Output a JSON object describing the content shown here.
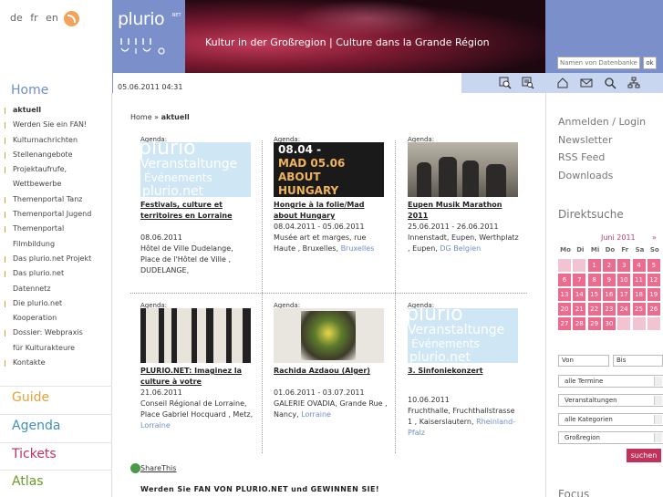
{
  "header": {
    "languages": [
      "de",
      "fr",
      "en"
    ],
    "logo_text": "plurio",
    "logo_net": ".NET",
    "tagline": "Kultur in der Großregion | Culture dans la Grande Région",
    "search_placeholder": "Namen von Datenbanken",
    "search_button": "ok"
  },
  "datetime": "05.06.2011 04:31",
  "left_nav": {
    "home": "Home",
    "items": [
      {
        "label": "aktuell",
        "active": true
      },
      {
        "label": "Werden Sie ein FAN!"
      },
      {
        "label": "Kulturnachrichten"
      },
      {
        "label": "Stellenangebote"
      },
      {
        "label": "Projektaufrufe,"
      },
      {
        "label": "Wettbewerbe",
        "plain": true
      },
      {
        "label": "Themenportal Tanz"
      },
      {
        "label": "Themenportal Jugend"
      },
      {
        "label": "Themenportal"
      },
      {
        "label": "Filmbildung",
        "plain": true
      },
      {
        "label": "Das plurio.net Projekt"
      },
      {
        "label": "Das plurio.net"
      },
      {
        "label": "Datennetz",
        "plain": true
      },
      {
        "label": "Die plurio.net"
      },
      {
        "label": "Kooperation",
        "plain": true
      },
      {
        "label": "Dossier: Webpraxis"
      },
      {
        "label": "für Kulturakteure",
        "plain": true
      },
      {
        "label": "Kontakte"
      }
    ],
    "sections": [
      {
        "label": "Guide",
        "color": "#e3a23a"
      },
      {
        "label": "Agenda",
        "color": "#3f8fb9"
      },
      {
        "label": "Tickets",
        "color": "#c2305c"
      },
      {
        "label": "Atlas",
        "color": "#6a9a2a"
      }
    ]
  },
  "breadcrumb": {
    "home": "Home",
    "sep": "»",
    "current": "aktuell"
  },
  "cards": [
    {
      "label": "Agenda:",
      "img": "ph",
      "title": "Festivals, culture et territoires en Lorraine",
      "dates": "08.06.2011",
      "place": "Hôtel de Ville Dudelange, Place de l'Hôtel de Ville , DUDELANGE,",
      "city": ""
    },
    {
      "label": "Agenda:",
      "img": "mad",
      "title": "Hongrie à la folie/Mad about Hungary",
      "dates": "08.04.2011 - 05.06.2011",
      "place": "Musée art et marges, rue Haute , Bruxelles,",
      "city": "Bruxelles"
    },
    {
      "label": "Agenda:",
      "img": "photo1",
      "title": "Eupen Musik Marathon 2011",
      "dates": "25.06.2011 - 26.06.2011",
      "place": "Innenstadt, Eupen, Werthplatz , Eupen,",
      "city": "DG Belgien"
    },
    {
      "label": "Agenda:",
      "img": "future",
      "title": "PLURIO.NET: Imaginez la culture à votre",
      "dates": "21.06.2011",
      "place": "Conseil Régional de Lorraine, Place Gabriel Hocquard , Metz,",
      "city": "Lorraine"
    },
    {
      "label": "Agenda:",
      "img": "painting",
      "title": "Rachida Azdaou (Alger)",
      "dates": "01.06.2011 - 03.07.2011",
      "place": "GALERIE OVADIA, Grande Rue , Nancy,",
      "city": "Lorraine"
    },
    {
      "label": "Agenda:",
      "img": "ph",
      "title": "3. Sinfoniekonzert",
      "dates": "10.06.2011",
      "place": "Fruchthalle, Fruchthallstrasse 1 , Kaiserslautern,",
      "city": "Rheinland-Pfalz"
    }
  ],
  "placeholder_img": {
    "w1": "plurio",
    "w2": "Veranstaltunge",
    "w3": "Événements",
    "w4": "plurio.net"
  },
  "mad_img": {
    "a": "08.04 -",
    "b": "MAD   05.06",
    "c": "ABOUT",
    "d": "HUNGARY"
  },
  "share": "ShareThis",
  "win_text": "Werden Sie FAN VON PLURIO.NET und GEWINNEN SIE!",
  "right": {
    "links": [
      "Anmelden / Login",
      "Newsletter",
      "RSS Feed",
      "Downloads"
    ],
    "direktsuche": "Direktsuche",
    "calendar": {
      "prev": "«",
      "month": "Juni 2011",
      "next": "»",
      "weekdays": [
        "Mo",
        "Di",
        "Mi",
        "Do",
        "Fr",
        "Sa",
        "So"
      ],
      "days": [
        "1",
        "2",
        "3",
        "4",
        "5",
        "6",
        "7",
        "8",
        "9",
        "10",
        "11",
        "12",
        "13",
        "14",
        "15",
        "16",
        "17",
        "18",
        "19",
        "20",
        "21",
        "22",
        "23",
        "24",
        "25",
        "26",
        "27",
        "28",
        "29",
        "30"
      ]
    },
    "von": "Von",
    "bis": "Bis",
    "selects": [
      "alle Termine",
      "Veranstaltungen",
      "alle Kategorien",
      "Großregion"
    ],
    "search_button": "suchen",
    "focus": "Focus"
  }
}
